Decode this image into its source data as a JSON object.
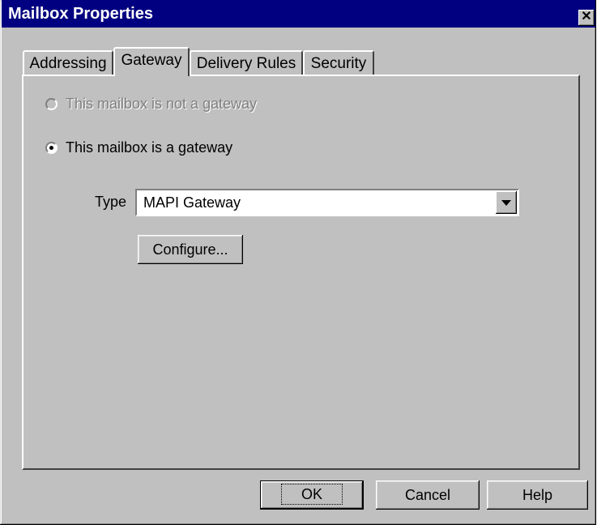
{
  "window": {
    "title": "Mailbox Properties",
    "close_glyph": "✕"
  },
  "tabs": [
    {
      "label": "Addressing",
      "active": false
    },
    {
      "label": "Gateway",
      "active": true
    },
    {
      "label": "Delivery Rules",
      "active": false
    },
    {
      "label": "Security",
      "active": false
    }
  ],
  "gateway": {
    "option_not_gateway": {
      "label": "This mailbox is not a gateway",
      "enabled": false,
      "selected": false
    },
    "option_is_gateway": {
      "label": "This mailbox is a gateway",
      "enabled": true,
      "selected": true
    },
    "type_label": "Type",
    "type_value": "MAPI Gateway",
    "configure_label": "Configure..."
  },
  "buttons": {
    "ok": "OK",
    "cancel": "Cancel",
    "help": "Help"
  }
}
